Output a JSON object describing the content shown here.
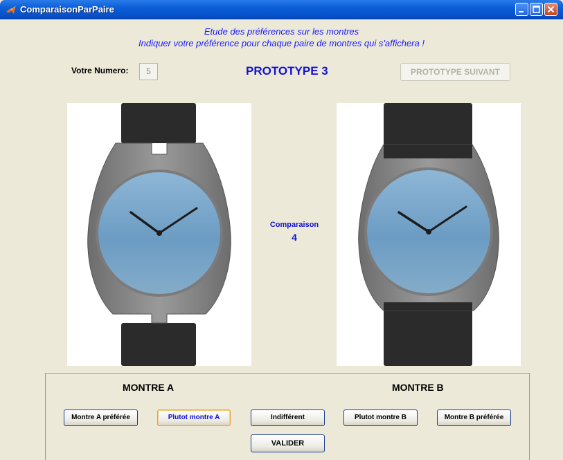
{
  "window": {
    "title": "ComparaisonParPaire",
    "app_icon": "matlab-icon",
    "controls": [
      "minimize-icon",
      "maximize-icon",
      "close-icon"
    ]
  },
  "header": {
    "line1": "Etude des préférences sur les montres",
    "line2": "Indiquer votre préférence pour chaque paire de montres qui s'affichera !"
  },
  "form": {
    "number_label": "Votre Numero:",
    "number_value": "5"
  },
  "prototype": {
    "title": "PROTOTYPE 3",
    "next_button": "PROTOTYPE SUIVANT"
  },
  "comparison": {
    "label": "Comparaison",
    "number": "4"
  },
  "choices": {
    "montre_a_label": "MONTRE A",
    "montre_b_label": "MONTRE B",
    "buttons": {
      "a_preferred": "Montre A préférée",
      "rather_a": "Plutot montre A",
      "indifferent": "Indifférent",
      "rather_b": "Plutot montre B",
      "b_preferred": "Montre B préférée",
      "validate": "VALIDER"
    }
  },
  "colors": {
    "accent_blue": "#1212d6",
    "dial_blue": "#7aa8cc",
    "case_gray": "#8c8c8c",
    "strap": "#2a2a2a",
    "focus_orange": "#e4a335"
  }
}
